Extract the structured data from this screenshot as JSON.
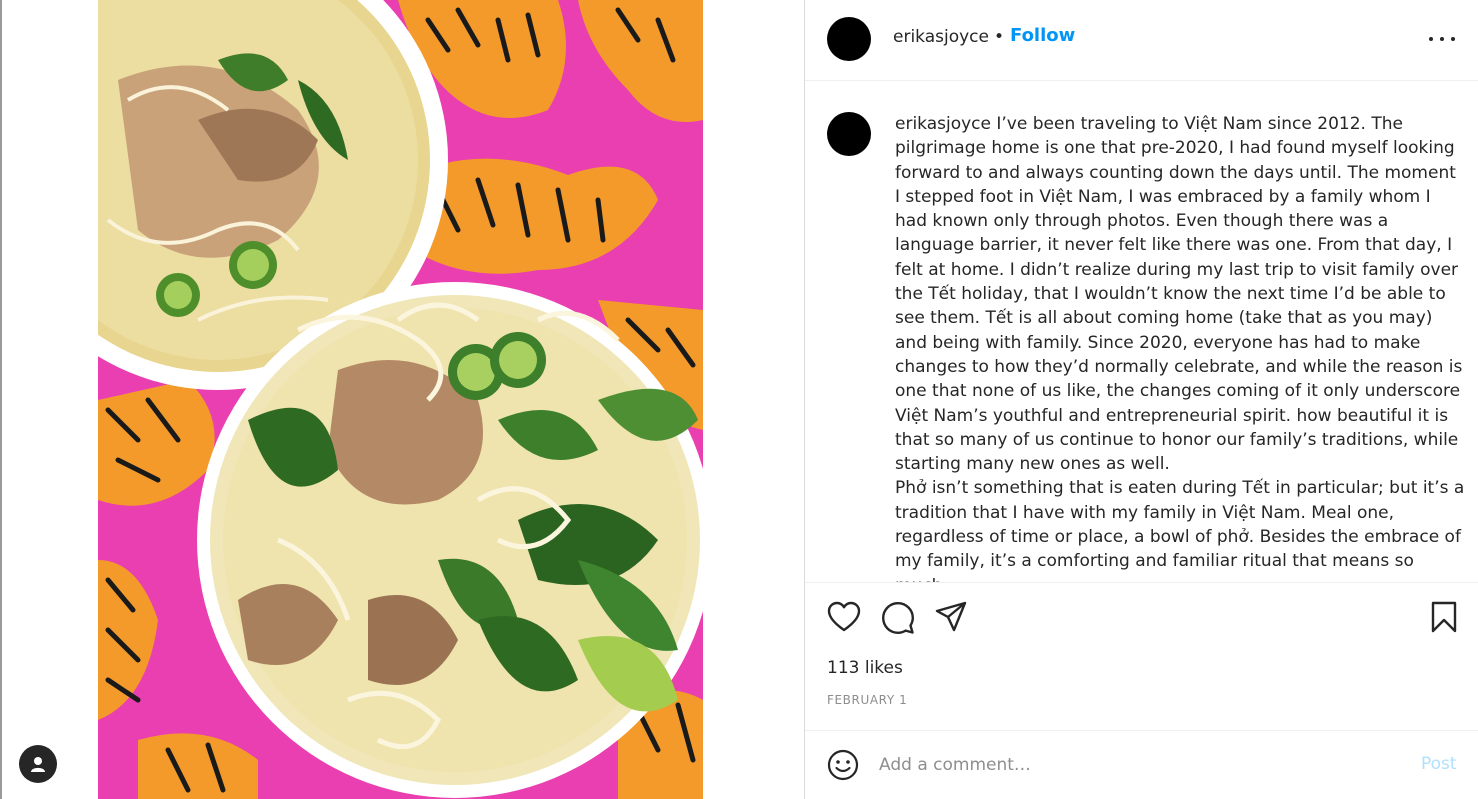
{
  "colors": {
    "accent": "#0095f6",
    "post_disabled": "#b2dffc",
    "photo_background": "#ea3fb0",
    "text": "#262626",
    "muted": "#8e8e8e"
  },
  "header": {
    "username": "erikasjoyce",
    "separator": "•",
    "follow_label": "Follow",
    "more_icon": "ellipsis-icon"
  },
  "caption": {
    "username": "erikasjoyce",
    "paragraph1": " I’ve been traveling to Việt Nam since 2012. The pilgrimage home is one that pre-2020, I had found myself looking forward to and always counting down the days until. The moment I stepped foot in Việt Nam, I was embraced by a family whom I had known only through photos. Even though there was a language barrier, it never felt like there was one. From that day, I felt at home. I didn’t realize during my last trip to visit family over the Tết holiday, that I wouldn’t know the next time I’d be able to see them. Tết is all about coming home (take that as you may) and being with family. Since 2020, everyone has had to make changes to how they’d normally celebrate, and while the reason is one that none of us like, the changes coming of it only underscore Việt Nam’s youthful and entrepreneurial spirit. how beautiful it is that so many of us continue to honor our family’s traditions, while starting many new ones as well.",
    "paragraph2": "Phở isn’t something that is eaten during Tết in particular; but it’s a tradition that I have with my family in Việt Nam. Meal one, regardless of time or place, a bowl of phở. Besides the embrace of my family, it’s a comforting and familiar ritual that means so much."
  },
  "actions": {
    "like_icon": "heart-icon",
    "comment_icon": "comment-icon",
    "share_icon": "send-icon",
    "save_icon": "bookmark-icon",
    "likes_text": "113 likes",
    "date_text": "FEBRUARY 1"
  },
  "comment": {
    "emoji_icon": "emoji-icon",
    "placeholder": "Add a comment…",
    "post_label": "Post"
  },
  "media": {
    "description_icon": "photo",
    "profile_icon": "user-icon"
  }
}
